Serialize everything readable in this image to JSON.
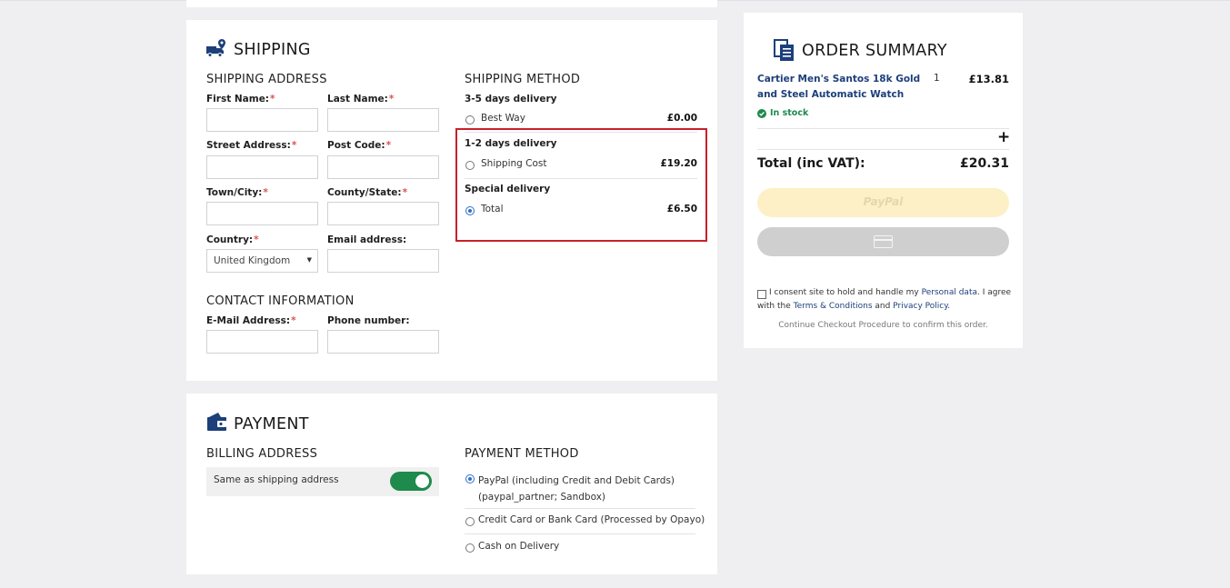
{
  "shipping": {
    "title": "SHIPPING",
    "address": {
      "title": "SHIPPING ADDRESS",
      "first_name": "First Name:",
      "last_name": "Last Name:",
      "street": "Street Address:",
      "post_code": "Post Code:",
      "town": "Town/City:",
      "county": "County/State:",
      "country": "Country:",
      "country_value": "United Kingdom",
      "email": "Email address:"
    },
    "contact": {
      "title": "CONTACT INFORMATION",
      "email": "E-Mail Address:",
      "phone": "Phone number:"
    },
    "method": {
      "title": "SHIPPING METHOD",
      "groups": [
        {
          "title": "3-5 days delivery",
          "option": "Best Way",
          "price": "£0.00",
          "selected": false
        },
        {
          "title": "1-2 days delivery",
          "option": "Shipping Cost",
          "price": "£19.20",
          "selected": false
        },
        {
          "title": "Special delivery",
          "option": "Total",
          "price": "£6.50",
          "selected": true
        }
      ]
    }
  },
  "payment": {
    "title": "PAYMENT",
    "billing_title": "BILLING ADDRESS",
    "same_as_shipping": "Same as shipping address",
    "same_as_shipping_on": true,
    "method_title": "PAYMENT METHOD",
    "methods": [
      {
        "line1": "PayPal (including Credit and Debit Cards)",
        "line2": "(paypal_partner; Sandbox)",
        "selected": true
      },
      {
        "line1": "Credit Card or Bank Card (Processed by Opayo)",
        "selected": false
      },
      {
        "line1": "Cash on Delivery",
        "selected": false
      }
    ]
  },
  "summary": {
    "title": "ORDER SUMMARY",
    "item_name_1": "Cartier Men's Santos 18k Gold",
    "item_name_2": "and Steel Automatic Watch",
    "item_qty": "1",
    "item_price": "£13.81",
    "stock": "In stock",
    "plus": "+",
    "total_label": "Total (inc VAT):",
    "total_value": "£20.31",
    "paypal_label": "PayPal",
    "consent_1": "I consent site to hold and handle my",
    "consent_link_1": "Personal data",
    "consent_2": ". I agree with",
    "consent_3": "the",
    "consent_link_2": "Terms & Conditions",
    "consent_4": "and",
    "consent_link_3": "Privacy Policy",
    "consent_5": ".",
    "continue_note": "Continue Checkout Procedure to confirm this order."
  },
  "colors": {
    "accent_blue": "#1d3f7a",
    "toggle_green": "#1e8a4c",
    "highlight_red": "#c8202a"
  }
}
